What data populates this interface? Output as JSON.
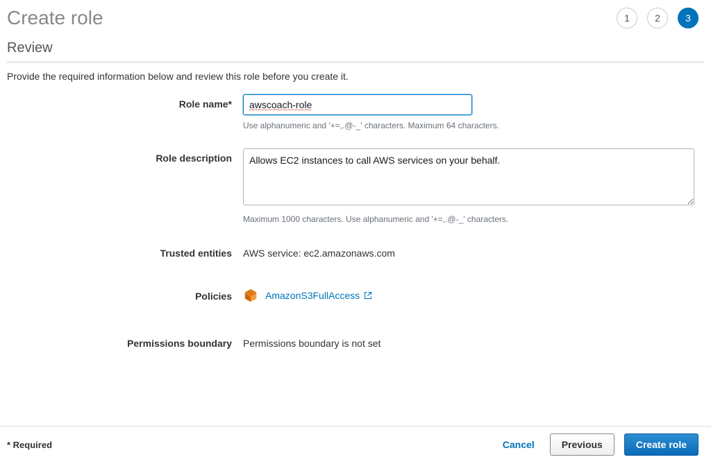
{
  "page_title": "Create role",
  "steps": [
    {
      "label": "1",
      "active": false
    },
    {
      "label": "2",
      "active": false
    },
    {
      "label": "3",
      "active": true
    }
  ],
  "section_title": "Review",
  "instruction": "Provide the required information below and review this role before you create it.",
  "form": {
    "role_name": {
      "label": "Role name*",
      "value": "awscoach-role",
      "help": "Use alphanumeric and '+=,.@-_' characters. Maximum 64 characters."
    },
    "role_description": {
      "label": "Role description",
      "value": "Allows EC2 instances to call AWS services on your behalf.",
      "help": "Maximum 1000 characters. Use alphanumeric and '+=,.@-_' characters."
    },
    "trusted_entities": {
      "label": "Trusted entities",
      "value": "AWS service: ec2.amazonaws.com"
    },
    "policies": {
      "label": "Policies",
      "link_text": "AmazonS3FullAccess"
    },
    "permissions_boundary": {
      "label": "Permissions boundary",
      "value": "Permissions boundary is not set"
    }
  },
  "footer": {
    "required": "* Required",
    "cancel": "Cancel",
    "previous": "Previous",
    "create": "Create role"
  }
}
